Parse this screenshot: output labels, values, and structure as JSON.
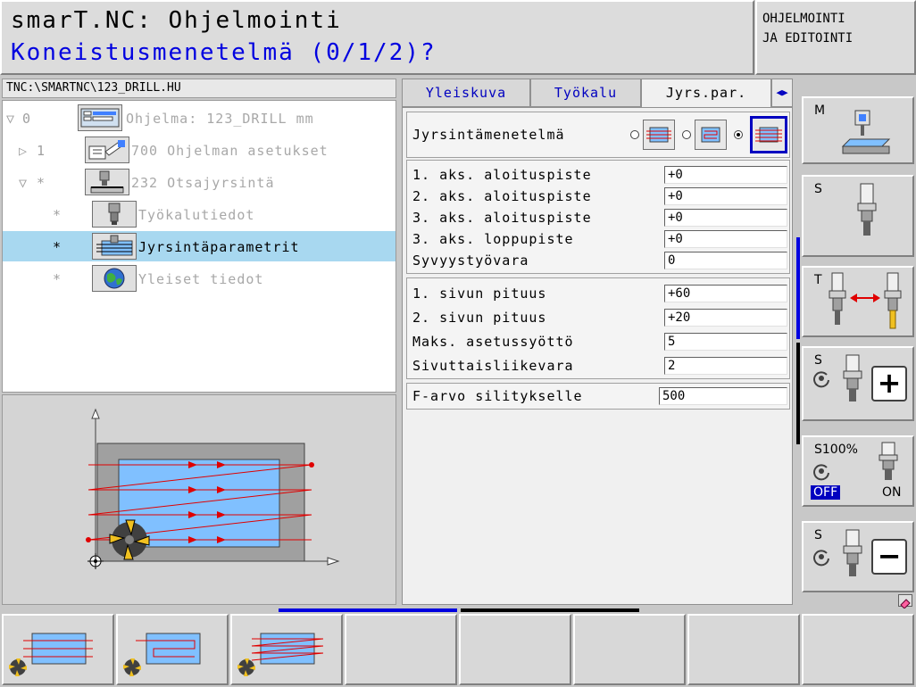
{
  "header": {
    "title": "smarT.NC: Ohjelmointi",
    "prompt": "Koneistusmenetelmä (0/1/2)?",
    "mode_line1": "OHJELMOINTI",
    "mode_line2": "JA EDITOINTI"
  },
  "path": "TNC:\\SMARTNC\\123_DRILL.HU",
  "tree": {
    "items": [
      {
        "lead": "▽",
        "index": "0",
        "label": "Ohjelma: 123_DRILL mm",
        "icon": "program-icon"
      },
      {
        "lead": "▷",
        "index": "1",
        "label": "700 Ohjelman asetukset",
        "icon": "program-settings-icon"
      },
      {
        "lead": "▽",
        "index": "*",
        "label": "232 Otsajyrsintä",
        "icon": "face-milling-icon"
      },
      {
        "lead": "",
        "index": "*",
        "label": "Työkalutiedot",
        "icon": "tool-data-icon"
      },
      {
        "lead": "",
        "index": "*",
        "label": "Jyrsintäparametrit",
        "icon": "milling-params-icon"
      },
      {
        "lead": "",
        "index": "*",
        "label": "Yleiset tiedot",
        "icon": "global-data-icon"
      }
    ]
  },
  "tabs": [
    {
      "label": "Yleiskuva",
      "active": false
    },
    {
      "label": "Työkalu",
      "active": false
    },
    {
      "label": "Jyrs.par.",
      "active": true
    }
  ],
  "form": {
    "method_label": "Jyrsintämenetelmä",
    "method_selected": 2,
    "group1": [
      {
        "label": "1. aks. aloituspiste",
        "value": "+0"
      },
      {
        "label": "2. aks. aloituspiste",
        "value": "+0"
      },
      {
        "label": "3. aks. aloituspiste",
        "value": "+0"
      },
      {
        "label": "3. aks. loppupiste",
        "value": "+0"
      },
      {
        "label": "Syvyystyövara",
        "value": "0"
      }
    ],
    "group2": [
      {
        "label": "1. sivun pituus",
        "value": "+60"
      },
      {
        "label": "2. sivun pituus",
        "value": "+20"
      },
      {
        "label": "Maks. asetussyöttö",
        "value": "5"
      },
      {
        "label": "Sivuttaisliikevara",
        "value": "2"
      }
    ],
    "group3": [
      {
        "label": "F-arvo silitykselle",
        "value": "500"
      }
    ]
  },
  "softkeys_right": [
    {
      "label": "M"
    },
    {
      "label": "S"
    },
    {
      "label": "T"
    },
    {
      "label": "S",
      "symbol": "+"
    },
    {
      "label": "S100%",
      "off": "OFF",
      "on": "ON"
    },
    {
      "label": "S",
      "symbol": "−"
    }
  ],
  "colors": {
    "prompt_blue": "#0000e0",
    "selection": "#a8d8f0",
    "workpiece_blue": "#80c0ff",
    "path_red": "#e00000"
  }
}
